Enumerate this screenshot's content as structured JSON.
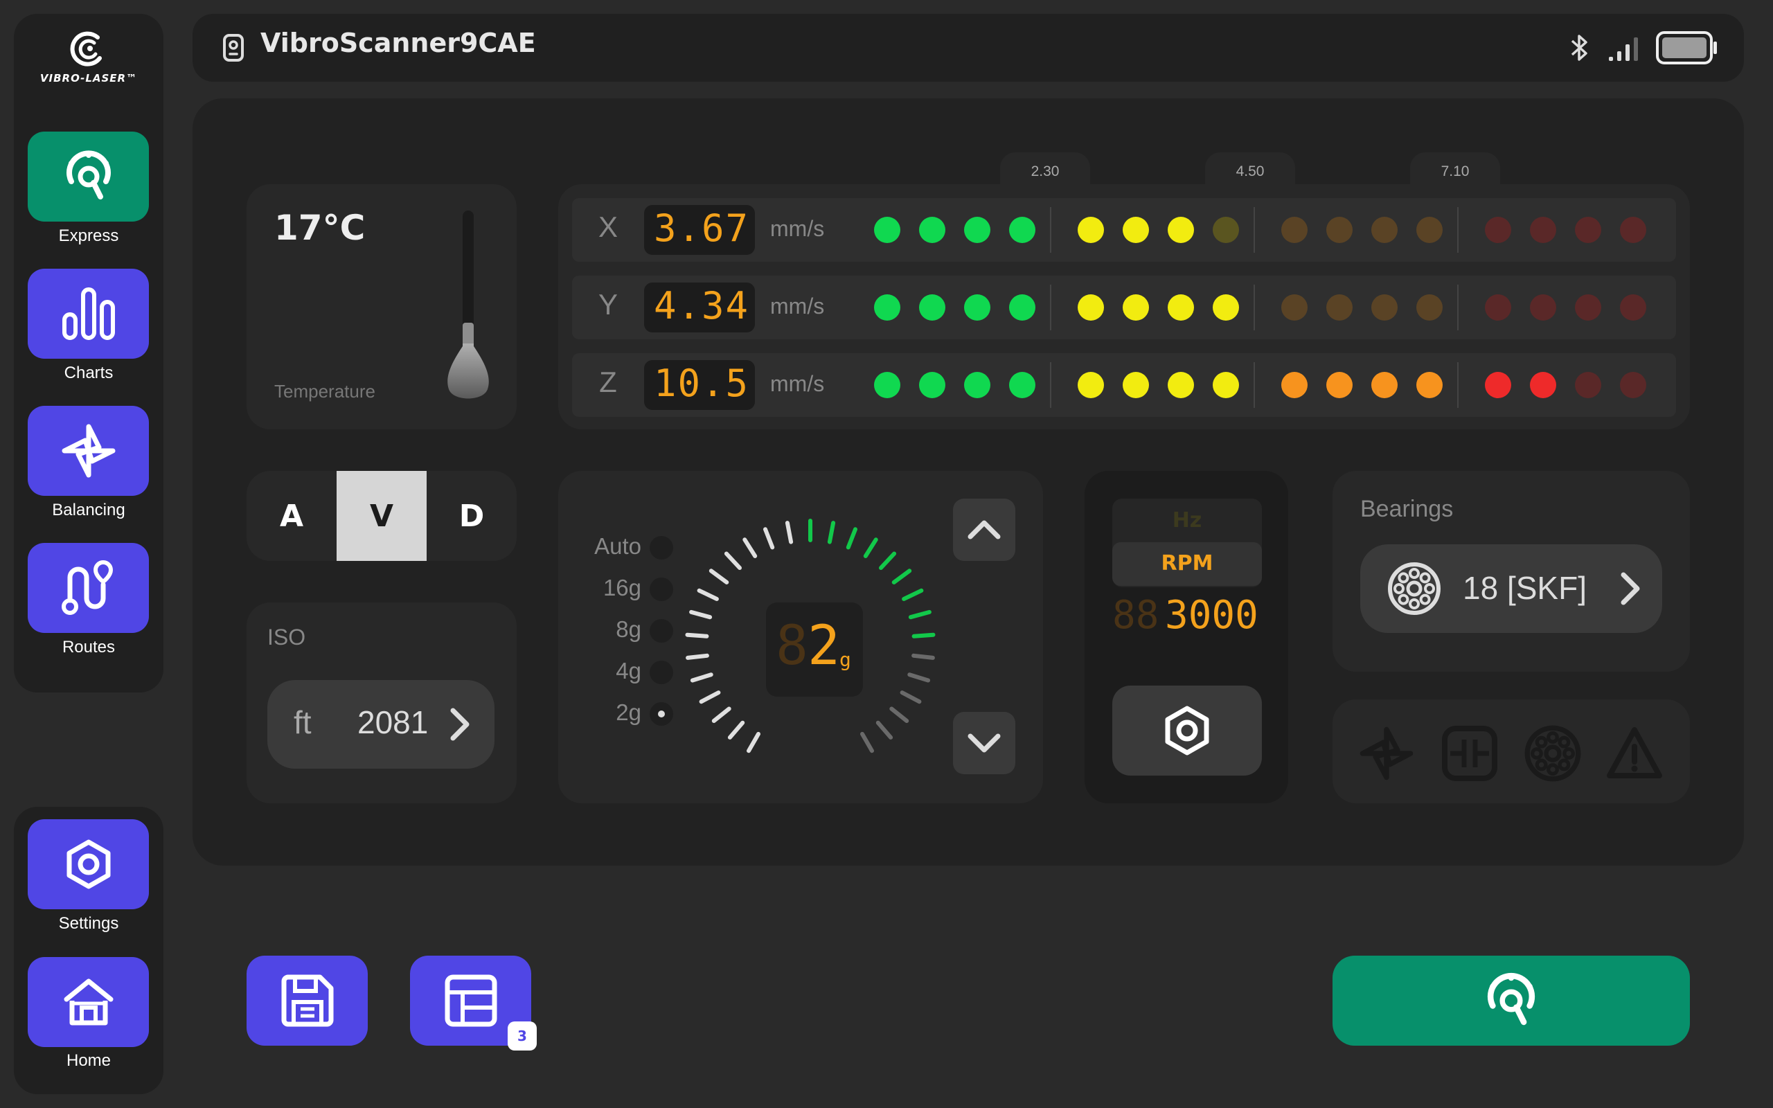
{
  "app": {
    "brand": "VIBRO-LASER™"
  },
  "sidebar": {
    "items": [
      {
        "label": "Express",
        "icon": "express-scan-icon"
      },
      {
        "label": "Charts",
        "icon": "bar-chart-icon"
      },
      {
        "label": "Balancing",
        "icon": "fan-icon"
      },
      {
        "label": "Routes",
        "icon": "route-icon"
      }
    ],
    "bottom": [
      {
        "label": "Settings",
        "icon": "gear-icon"
      },
      {
        "label": "Home",
        "icon": "home-icon"
      }
    ]
  },
  "header": {
    "device_name": "VibroScanner9CAE",
    "status_icons": [
      "bluetooth-icon",
      "signal-icon",
      "battery-icon"
    ]
  },
  "temperature": {
    "value": "17°C",
    "label": "Temperature"
  },
  "iso_zones": {
    "thresholds": [
      "2.30",
      "4.50",
      "7.10"
    ]
  },
  "axes": [
    {
      "axis": "X",
      "value": "3.67",
      "unit": "mm/s",
      "lit": [
        4,
        3,
        0,
        0
      ]
    },
    {
      "axis": "Y",
      "value": "4.34",
      "unit": "mm/s",
      "lit": [
        4,
        4,
        0,
        0
      ]
    },
    {
      "axis": "Z",
      "value": "10.5",
      "unit": "mm/s",
      "lit": [
        4,
        4,
        4,
        2
      ]
    }
  ],
  "zone_colors": {
    "on": [
      "#10d850",
      "#f2ec10",
      "#f7931e",
      "#ee2a2a"
    ],
    "off": [
      "#0a4a20",
      "#5a5520",
      "#5a4325",
      "#5a2828"
    ]
  },
  "mode": {
    "options": [
      "A",
      "V",
      "D"
    ],
    "selected": "V"
  },
  "iso": {
    "label": "ISO",
    "unit": "ft",
    "value": "2081"
  },
  "range": {
    "options": [
      "Auto",
      "16g",
      "8g",
      "4g",
      "2g"
    ],
    "selected": "2g",
    "display_value": "2",
    "display_unit": "g",
    "level_fraction": 0.25
  },
  "frequency": {
    "hz_label": "Hz",
    "rpm_label": "RPM",
    "value": "3000"
  },
  "bearings": {
    "label": "Bearings",
    "value": "18 [SKF]"
  },
  "status_icons": [
    "fan-icon",
    "coupling-icon",
    "bearing-icon",
    "warning-icon"
  ],
  "bottom": {
    "report_badge": "3"
  }
}
